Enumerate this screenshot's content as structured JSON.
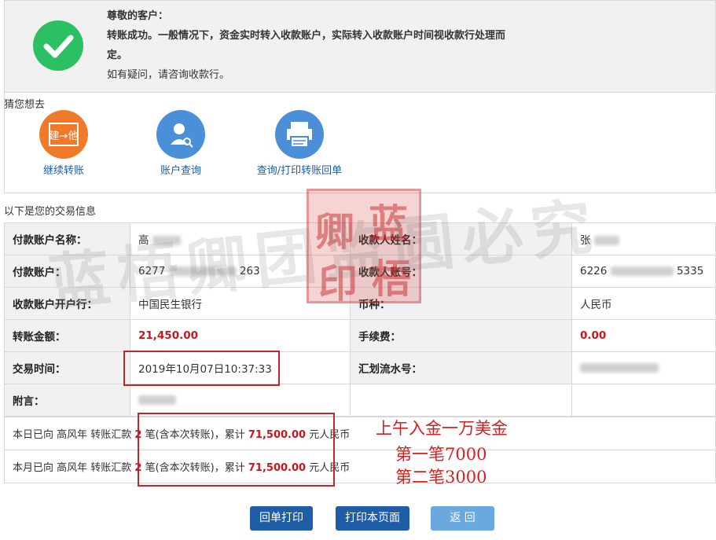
{
  "notice": {
    "greeting": "尊敬的客户：",
    "line1": "转账成功。一般情况下，资金实时转入收款账户，实际转入收款账户时间视收款行处理而",
    "line2": "定。",
    "line3": "如有疑问，请咨询收款行。"
  },
  "guess": {
    "title": "猜您想去",
    "items": [
      {
        "label": "继续转账",
        "icon": "transfer-icon",
        "icon_text": "建→他",
        "color": "#f07a2a"
      },
      {
        "label": "账户查询",
        "icon": "user-search-icon",
        "color": "#4a8fd8"
      },
      {
        "label": "查询/打印转账回单",
        "icon": "printer-icon",
        "color": "#4a8fd8"
      }
    ]
  },
  "tx": {
    "title": "以下是您的交易信息",
    "payer_name_label": "付款账户名称：",
    "payer_name": "高",
    "payee_name_label": "收款人姓名：",
    "payee_name": "张",
    "payer_account_label": "付款账户：",
    "payer_account_start": "6277",
    "payer_account_end": "263",
    "payee_account_label": "收款人账号：",
    "payee_account_start": "6226",
    "payee_account_end": "5335",
    "bank_label": "收款账户开户行：",
    "bank": "中国民生银行",
    "currency_label": "币种：",
    "currency": "人民币",
    "amount_label": "转账金额：",
    "amount": "21,450.00",
    "fee_label": "手续费：",
    "fee": "0.00",
    "time_label": "交易时间：",
    "time": "2019年10月07日10:37:33",
    "serial_label": "汇划流水号：",
    "note_label": "附言："
  },
  "stats": {
    "today_prefix": "本日已向 高风年 转账汇款",
    "month_prefix": "本月已向 高风年 转账汇款",
    "count": "2",
    "count_suffix": "笔(含本次转账)，累计",
    "total": "71,500.00",
    "unit": "元人民币"
  },
  "handwriting": {
    "line1": "上午入金一万美金",
    "line2": "第一笔7000",
    "line3": "第二笔3000"
  },
  "seal": {
    "chars": [
      "卿",
      "蓝",
      "印",
      "梧"
    ]
  },
  "watermark": "蓝梧卿团监圆必究",
  "buttons": {
    "receipt_print": "回单打印",
    "print_page": "打印本页面",
    "back": "返 回"
  }
}
